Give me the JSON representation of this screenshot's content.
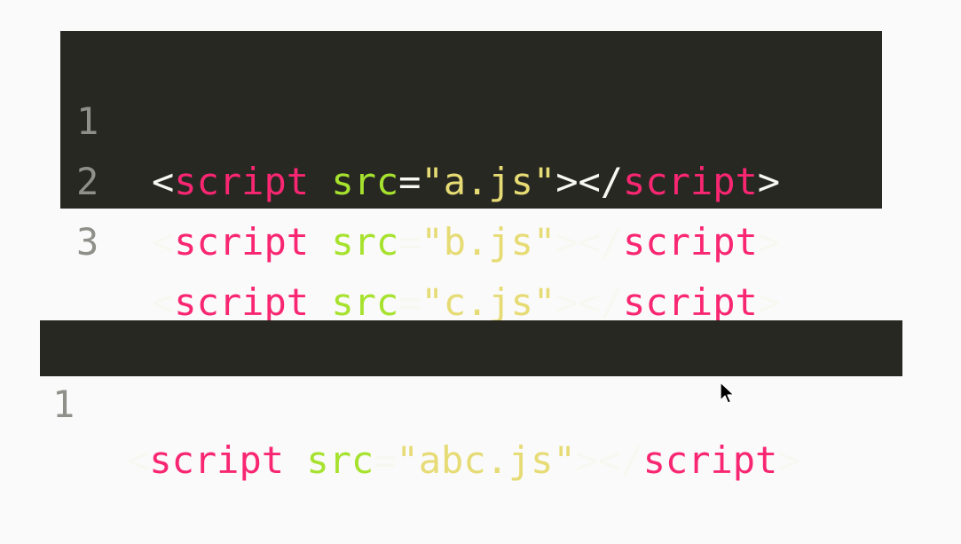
{
  "colors": {
    "background": "#fafafa",
    "editor_bg": "#272822",
    "line_number": "#8f908a",
    "punctuation": "#f8f8f2",
    "tag": "#f92672",
    "attribute": "#a6e22e",
    "string": "#e6db74"
  },
  "block_top": {
    "lines": [
      {
        "number": "1",
        "open_bracket": "<",
        "tag": "script",
        "attr": "src",
        "equals": "=",
        "value": "\"a.js\"",
        "close_open": "></",
        "close_tag": "script",
        "close_bracket": ">"
      },
      {
        "number": "2",
        "open_bracket": "<",
        "tag": "script",
        "attr": "src",
        "equals": "=",
        "value": "\"b.js\"",
        "close_open": "></",
        "close_tag": "script",
        "close_bracket": ">"
      },
      {
        "number": "3",
        "open_bracket": "<",
        "tag": "script",
        "attr": "src",
        "equals": "=",
        "value": "\"c.js\"",
        "close_open": "></",
        "close_tag": "script",
        "close_bracket": ">"
      }
    ]
  },
  "block_bottom": {
    "lines": [
      {
        "number": "1",
        "open_bracket": "<",
        "tag": "script",
        "attr": "src",
        "equals": "=",
        "value": "\"abc.js\"",
        "close_open": "></",
        "close_tag": "script",
        "close_bracket": ">"
      }
    ]
  },
  "cursor_icon": "mouse-pointer-icon"
}
